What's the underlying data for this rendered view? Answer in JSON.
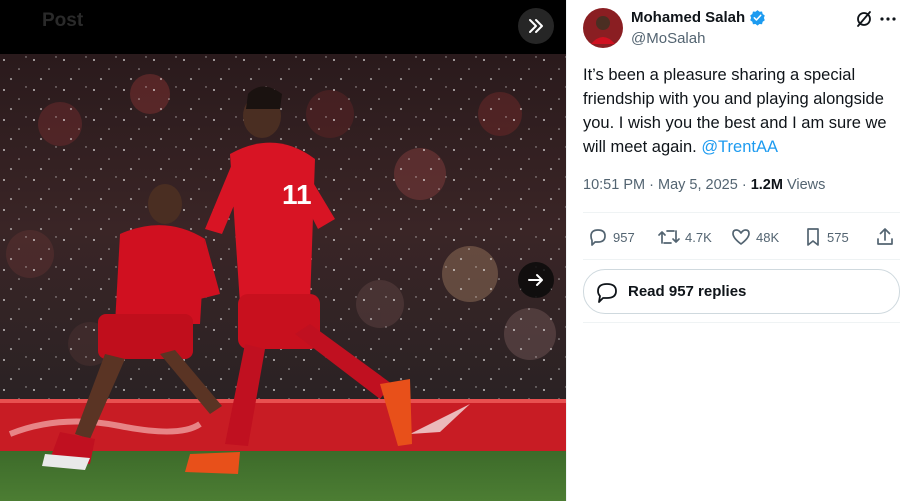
{
  "media": {
    "header_title": "Post",
    "collapse_icon": "double-chevron-right-icon",
    "next_icon": "arrow-right-icon",
    "photo_alt": "Photo"
  },
  "tweet": {
    "author_name": "Mohamed Salah",
    "author_handle": "@MoSalah",
    "verified_icon": "verified-badge-icon",
    "body": "It’s been a pleasure sharing a special friendship with you and playing alongside you. I wish you the best and I am sure we will meet again. ",
    "mention": "@TrentAA",
    "time": "10:51 PM",
    "separator": "·",
    "date": "May 5, 2025",
    "views_count": "1.2M",
    "views_label": "Views",
    "actions": {
      "replies": "957",
      "reposts": "4.7K",
      "likes": "48K",
      "bookmarks": "575"
    },
    "read_replies": "Read 957 replies"
  },
  "colors": {
    "accent": "#1d9bf0",
    "text_primary": "#0f1419",
    "text_secondary": "#536471",
    "kit_red": "#d01020"
  }
}
